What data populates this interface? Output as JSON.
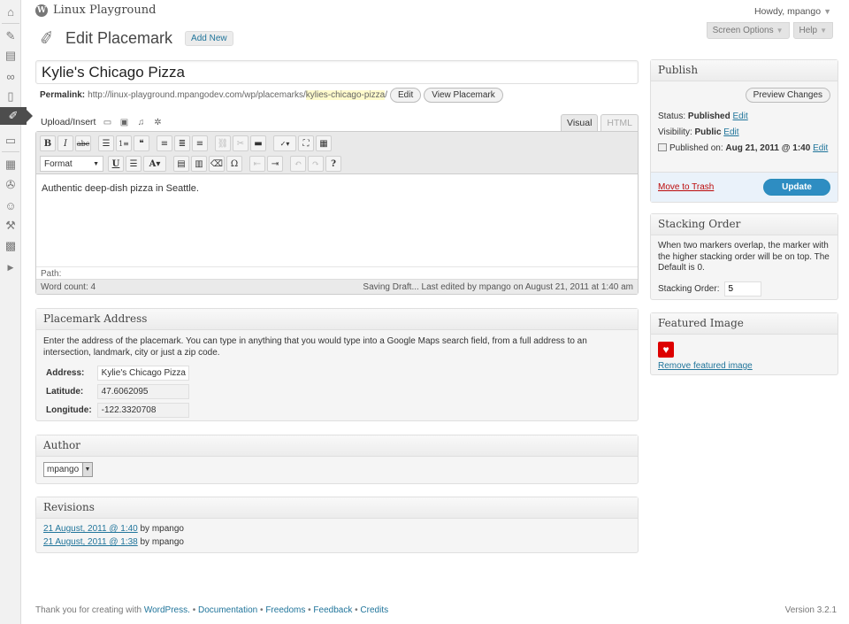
{
  "header": {
    "site_name": "Linux Playground",
    "howdy": "Howdy, mpango",
    "screen_options": "Screen Options",
    "help": "Help"
  },
  "page": {
    "title": "Edit Placemark",
    "add_new": "Add New"
  },
  "post": {
    "title": "Kylie's Chicago Pizza",
    "permalink_label": "Permalink:",
    "permalink_base": "http://linux-playground.mpangodev.com/wp/placemarks/",
    "permalink_slug": "kylies-chicago-pizza",
    "permalink_trail": "/",
    "edit_btn": "Edit",
    "view_btn": "View Placemark"
  },
  "editor": {
    "upload_label": "Upload/Insert",
    "tab_visual": "Visual",
    "tab_html": "HTML",
    "format_label": "Format",
    "content": "Authentic deep-dish pizza in Seattle.",
    "path_label": "Path:",
    "word_count": "Word count: 4",
    "status": "Saving Draft... Last edited by mpango on August 21, 2011 at 1:40 am"
  },
  "address_box": {
    "title": "Placemark Address",
    "description": "Enter the address of the placemark. You can type in anything that you would type into a Google Maps search field, from a full address to an intersection, landmark, city or just a zip code.",
    "address_label": "Address:",
    "address_value": "Kylie's Chicago Pizza Se",
    "latitude_label": "Latitude:",
    "latitude_value": "47.6062095",
    "longitude_label": "Longitude:",
    "longitude_value": "-122.3320708"
  },
  "author_box": {
    "title": "Author",
    "selected": "mpango"
  },
  "revisions_box": {
    "title": "Revisions",
    "items": [
      {
        "link": "21 August, 2011 @ 1:40",
        "by": "by mpango"
      },
      {
        "link": "21 August, 2011 @ 1:38",
        "by": "by mpango"
      }
    ]
  },
  "publish_box": {
    "title": "Publish",
    "preview_btn": "Preview Changes",
    "status_label": "Status:",
    "status_value": "Published",
    "visibility_label": "Visibility:",
    "visibility_value": "Public",
    "published_label": "Published on:",
    "published_value": "Aug 21, 2011 @ 1:40",
    "edit": "Edit",
    "trash": "Move to Trash",
    "update": "Update"
  },
  "stacking_box": {
    "title": "Stacking Order",
    "description": "When two markers overlap, the marker with the higher stacking order will be on top. The Default is 0.",
    "label": "Stacking Order:",
    "value": "5"
  },
  "featured_box": {
    "title": "Featured Image",
    "remove_link": "Remove featured image"
  },
  "footer": {
    "thanks": "Thank you for creating with",
    "wordpress": "WordPress.",
    "documentation": "Documentation",
    "freedoms": "Freedoms",
    "feedback": "Feedback",
    "credits": "Credits",
    "sep": "•",
    "version": "Version 3.2.1"
  },
  "colors": {
    "link": "#21759b",
    "update_button": "#2e8dc2",
    "trash": "#bc0b0b",
    "slug_highlight": "#fffbcc"
  }
}
